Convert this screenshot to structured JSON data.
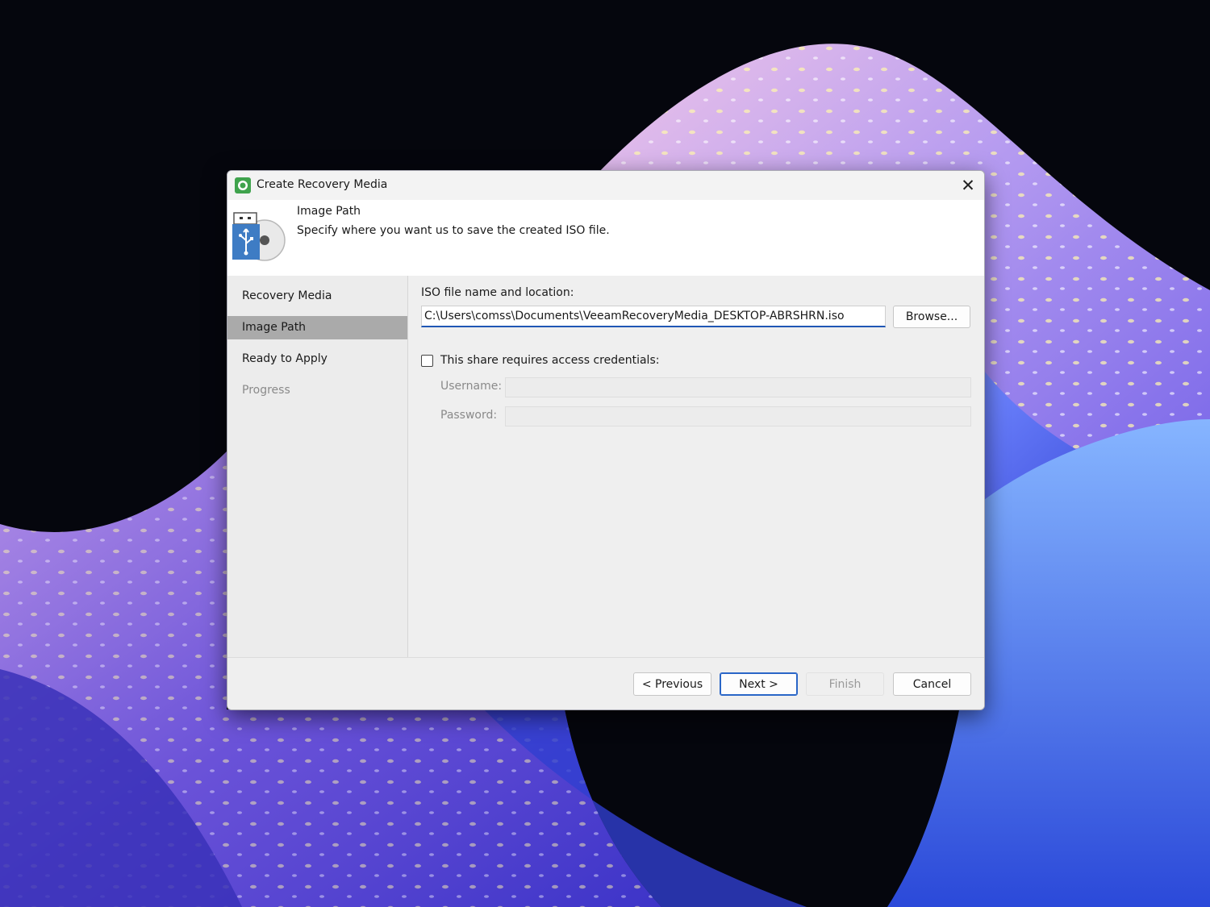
{
  "window": {
    "title": "Create Recovery Media",
    "close_glyph": "✕"
  },
  "header": {
    "title": "Image Path",
    "description": "Specify where you want us to save the created ISO file.",
    "icon": "usb-disc-icon"
  },
  "nav": {
    "items": [
      {
        "label": "Recovery Media",
        "state": "normal"
      },
      {
        "label": "Image Path",
        "state": "selected"
      },
      {
        "label": "Ready to Apply",
        "state": "normal"
      },
      {
        "label": "Progress",
        "state": "disabled"
      }
    ]
  },
  "form": {
    "iso_label": "ISO file name and location:",
    "iso_value": "C:\\Users\\comss\\Documents\\VeeamRecoveryMedia_DESKTOP-ABRSHRN.iso",
    "browse_label": "Browse...",
    "credentials_label": "This share requires access credentials:",
    "credentials_checked": false,
    "username_label": "Username:",
    "username_value": "",
    "password_label": "Password:",
    "password_value": ""
  },
  "footer": {
    "previous_label": "< Previous",
    "next_label": "Next >",
    "finish_label": "Finish",
    "cancel_label": "Cancel"
  },
  "colors": {
    "accent": "#1f57b5",
    "selected_nav": "#aaaaaa",
    "dialog_bg": "#efefef"
  }
}
